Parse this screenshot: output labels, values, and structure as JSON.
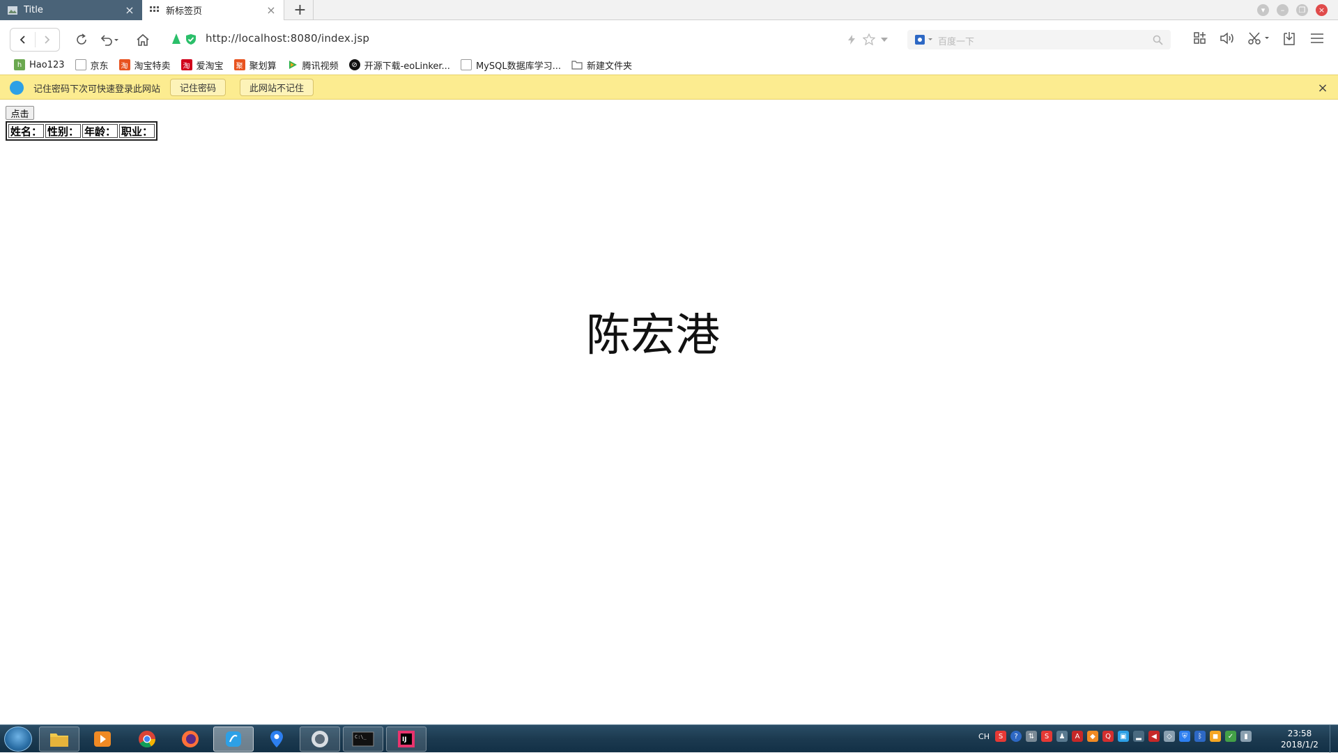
{
  "browser": {
    "tabs": [
      {
        "title": "Title",
        "state": "active"
      },
      {
        "title": "新标签页",
        "state": "inactive"
      }
    ],
    "url": "http://localhost:8080/index.jsp",
    "search_placeholder": "百度一下"
  },
  "bookmarks": [
    {
      "label": "Hao123",
      "icon": "hao123-icon",
      "color": "#6aa84f"
    },
    {
      "label": "京东",
      "icon": "page-icon",
      "color": "#999999"
    },
    {
      "label": "淘宝特卖",
      "icon": "taobao-icon",
      "color": "#e8531f"
    },
    {
      "label": "爱淘宝",
      "icon": "aitaobao-icon",
      "color": "#d0021b"
    },
    {
      "label": "聚划算",
      "icon": "juhuasuan-icon",
      "color": "#e8531f"
    },
    {
      "label": "腾讯视频",
      "icon": "tencent-video-icon",
      "color": "#31b14a"
    },
    {
      "label": "开源下载-eoLinker...",
      "icon": "eolinker-icon",
      "color": "#111111"
    },
    {
      "label": "MySQL数据库学习...",
      "icon": "page-icon",
      "color": "#999999"
    },
    {
      "label": "新建文件夹",
      "icon": "folder-icon",
      "color": "#666666"
    }
  ],
  "infobar": {
    "message": "记住密码下次可快速登录此网站",
    "remember_label": "记住密码",
    "never_label": "此网站不记住"
  },
  "page": {
    "button_label": "点击",
    "table_headers": [
      "姓名：",
      "性别：",
      "年龄：",
      "职业："
    ],
    "big_text": "陈宏港"
  },
  "taskbar": {
    "apps": [
      "file-explorer",
      "media-player",
      "chrome",
      "firefox",
      "browser-active",
      "maps",
      "app-circle",
      "cmd",
      "intellij"
    ],
    "tray_lang": "CH",
    "time": "23:58",
    "date": "2018/1/2"
  },
  "colors": {
    "active_tab": "#4a6378",
    "infobar": "#fcec90",
    "taskbar": "#1c3a50",
    "secure_green": "#2bbf6a"
  }
}
